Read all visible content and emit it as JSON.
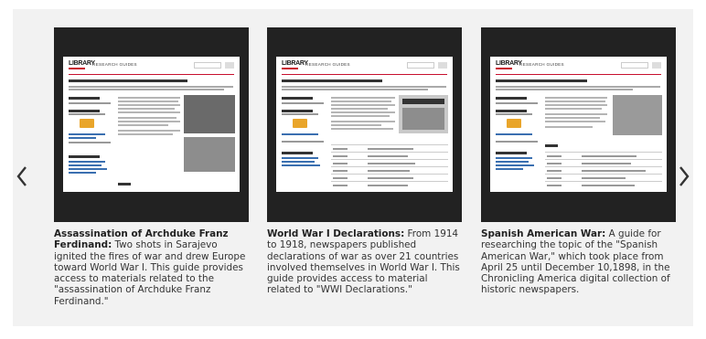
{
  "carousel": {
    "prev_icon": "chevron-left-icon",
    "next_icon": "chevron-right-icon",
    "thumbnail_header": {
      "logo_text": "LIBRARY",
      "brand_text": "RESEARCH GUIDES"
    },
    "items": [
      {
        "title": "Assassination of Archduke Franz Ferdinand:",
        "description": " Two shots in Sarajevo ignited the fires of war and drew Europe toward World War I. This guide provides access to materials related to the \"assassination of Archduke Franz Ferdinand.\""
      },
      {
        "title": "World War I Declarations:",
        "description": " From 1914 to 1918, newspapers published declarations of war as over 21 countries involved themselves in World War I. This guide provides access to material related to \"WWI Declarations.\""
      },
      {
        "title": "Spanish American War:",
        "description": " A guide for researching the topic of the \"Spanish American War,\" which took place from April 25 until December 10,1898, in the Chronicling America digital collection of historic newspapers."
      }
    ]
  }
}
